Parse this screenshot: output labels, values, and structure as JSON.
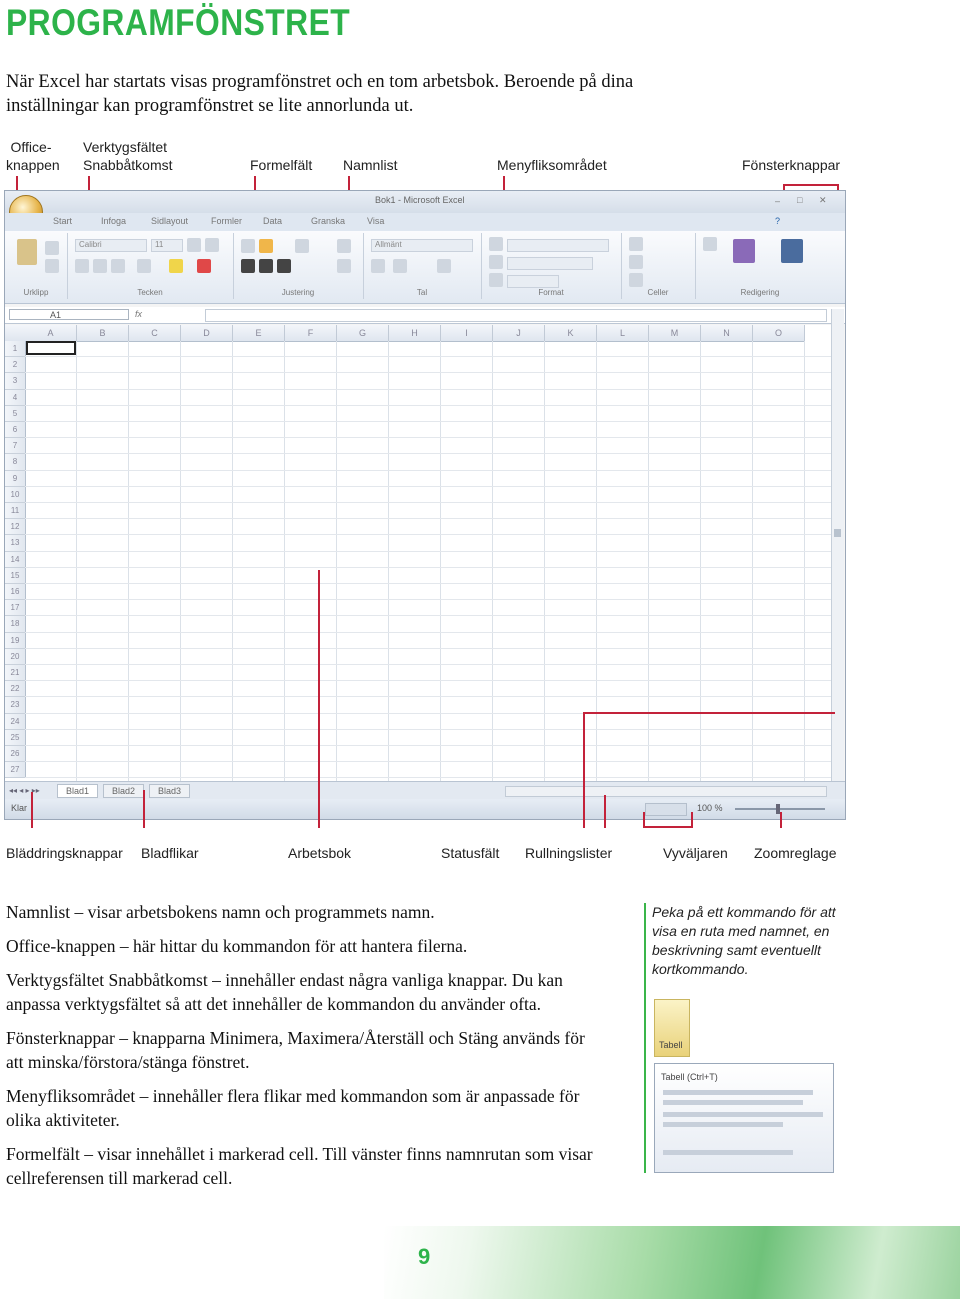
{
  "title": "PROGRAMFÖNSTRET",
  "intro": "När Excel har startats visas programfönstret och en tom arbetsbok. Beroende på dina inställningar kan programfönstret se lite annorlunda ut.",
  "top_labels": {
    "office_line1": "Office-",
    "office_line2": "knappen",
    "quickbar_line1": "Verktygsfältet",
    "quickbar_line2": "Snabbåtkomst",
    "formula": "Formelfält",
    "namelist": "Namnlist",
    "ribbon": "Menyfliksområdet",
    "window_buttons": "Fönsterknappar"
  },
  "bottom_labels": {
    "browse_buttons": "Bläddringsknappar",
    "sheet_tabs": "Bladflikar",
    "workbook": "Arbetsbok",
    "status_bar": "Statusfält",
    "scrollbars": "Rullningslister",
    "view_selector": "Vyväljaren",
    "zoom_slider": "Zoomreglage"
  },
  "screenshot": {
    "window_title": "Bok1 - Microsoft Excel",
    "tabs": [
      "Start",
      "Infoga",
      "Sidlayout",
      "Formler",
      "Data",
      "Granska",
      "Visa"
    ],
    "groups": [
      "Urklipp",
      "Tecken",
      "Justering",
      "Tal",
      "Format",
      "Celler",
      "Redigering"
    ],
    "font_name": "Calibri",
    "font_size": "11",
    "number_format": "Allmänt",
    "name_box": "A1",
    "fx": "fx",
    "columns": [
      "A",
      "B",
      "C",
      "D",
      "E",
      "F",
      "G",
      "H",
      "I",
      "J",
      "K",
      "L",
      "M",
      "N",
      "O"
    ],
    "rows": [
      "1",
      "2",
      "3",
      "4",
      "5",
      "6",
      "7",
      "8",
      "9",
      "10",
      "11",
      "12",
      "13",
      "14",
      "15",
      "16",
      "17",
      "18",
      "19",
      "20",
      "21",
      "22",
      "23",
      "24",
      "25",
      "26",
      "27"
    ],
    "sheet_tabs": [
      "Blad1",
      "Blad2",
      "Blad3"
    ],
    "status_left": "Klar",
    "zoom": "100 %"
  },
  "paragraphs": [
    "Namnlist – visar arbetsbokens namn och programmets namn.",
    "Office-knappen – här hittar du kommandon för att hantera filerna.",
    "Verktygsfältet Snabbåtkomst – innehåller endast några vanliga knappar. Du kan anpassa verktygsfältet så att det innehåller de kommandon du använder ofta.",
    "Fönsterknappar – knapparna Minimera, Maximera/Återställ och Stäng används för att minska/förstora/stänga fönstret.",
    "Menyfliksområdet – innehåller flera flikar med kommandon som är anpassade för olika aktiviteter.",
    "Formelfält – visar innehållet i markerad cell. Till vänster finns namnrutan som visar cellreferensen till markerad cell."
  ],
  "sidebar": {
    "tip": "Peka på ett kommando för att visa en ruta med namnet, en beskrivning samt eventuellt kortkommando.",
    "button_label": "Tabell",
    "tooltip_title": "Tabell (Ctrl+T)"
  },
  "page_number": "9",
  "colors": {
    "accent_green": "#2db34a",
    "callout_red": "#c3223a"
  }
}
